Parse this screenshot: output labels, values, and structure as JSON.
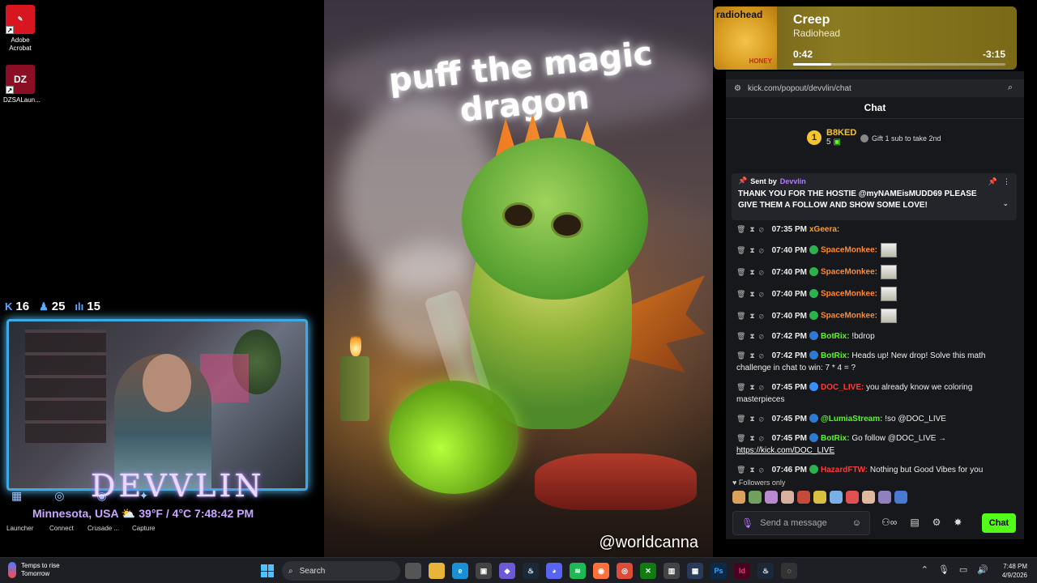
{
  "desktop": {
    "icons": [
      {
        "label": "Adobe Acrobat",
        "icon": "acrobat-icon",
        "color": "#d8161f"
      },
      {
        "label": "DZSALaun...",
        "icon": "dzsa-launcher-icon",
        "color": "#8a0f24"
      }
    ]
  },
  "stream": {
    "stats": [
      {
        "icon": "kick-icon",
        "value": "16"
      },
      {
        "icon": "person-icon",
        "value": "25"
      },
      {
        "icon": "bars-icon",
        "value": "15"
      }
    ],
    "brand": "DEVVLIN",
    "weather": {
      "location": "Minnesota, USA",
      "temp": "39°F / 4°C",
      "time": "7:48:42 PM"
    },
    "launchers": [
      "Launcher",
      "Connect",
      "Crusade ...",
      "Capture"
    ]
  },
  "artwork": {
    "title": "puff the magic dragon",
    "watermark": "@worldcanna"
  },
  "media": {
    "album_label": "radiohead",
    "album_sub": "HONEY",
    "title": "Creep",
    "artist": "Radiohead",
    "elapsed": "0:42",
    "remaining": "-3:15",
    "progress_fraction": 0.18
  },
  "chat": {
    "url": "kick.com/popout/devvlin/chat",
    "title": "Chat",
    "leader": {
      "rank": "1",
      "name": "B8KED",
      "count": "5"
    },
    "gift_text": "Gift 1 sub to take 2nd",
    "pinned": {
      "sent_by": "Sent by",
      "author": "Devvlin",
      "message": "THANK YOU FOR THE HOSTIE @myNAMEisMUDD69 PLEASE GIVE THEM A FOLLOW AND SHOW SOME LOVE!"
    },
    "messages": [
      {
        "time": "07:35 PM",
        "user": "xGeera:",
        "color": "#ff9c2a",
        "badge": "",
        "text": ""
      },
      {
        "time": "07:40 PM",
        "user": "SpaceMonkee:",
        "color": "#ff8a30",
        "badge": "#2bb24c",
        "text": "",
        "emote": true
      },
      {
        "time": "07:40 PM",
        "user": "SpaceMonkee:",
        "color": "#ff8a30",
        "badge": "#2bb24c",
        "text": "",
        "emote": true
      },
      {
        "time": "07:40 PM",
        "user": "SpaceMonkee:",
        "color": "#ff8a30",
        "badge": "#2bb24c",
        "text": "",
        "emote": true
      },
      {
        "time": "07:40 PM",
        "user": "SpaceMonkee:",
        "color": "#ff8a30",
        "badge": "#2bb24c",
        "text": "",
        "emote": true
      },
      {
        "time": "07:42 PM",
        "user": "BotRix:",
        "color": "#53fc18",
        "badge": "#2b7bd6",
        "text": "!bdrop"
      },
      {
        "time": "07:42 PM",
        "user": "BotRix:",
        "color": "#53fc18",
        "badge": "#2b7bd6",
        "text": "Heads up! New drop! Solve this math challenge in chat to win: 7 * 4 = ?"
      },
      {
        "time": "07:45 PM",
        "user": "DOC_LIVE:",
        "color": "#ff3b3b",
        "badge": "#3a8dff",
        "text": "you already know we coloring masterpieces"
      },
      {
        "time": "07:45 PM",
        "user": "@LumiaStream:",
        "color": "#53fc18",
        "badge": "#2b7bd6",
        "text": "!so @DOC_LIVE"
      },
      {
        "time": "07:45 PM",
        "user": "BotRix:",
        "color": "#53fc18",
        "badge": "#2b7bd6",
        "text": "Go follow @DOC_LIVE →",
        "link": "https://kick.com/DOC_LIVE"
      },
      {
        "time": "07:46 PM",
        "user": "HazardFTW:",
        "color": "#ff3b3b",
        "badge": "#2bb24c",
        "text": "Nothing but Good Vibes for you"
      }
    ],
    "followers_only": "Followers only",
    "input_placeholder": "Send a message",
    "send_label": "Chat",
    "accent": "#53fc18"
  },
  "taskbar": {
    "weather_line1": "Temps to rise",
    "weather_line2": "Tomorrow",
    "search_placeholder": "Search",
    "clock_time": "7:48 PM",
    "clock_date": "4/9/2026"
  }
}
